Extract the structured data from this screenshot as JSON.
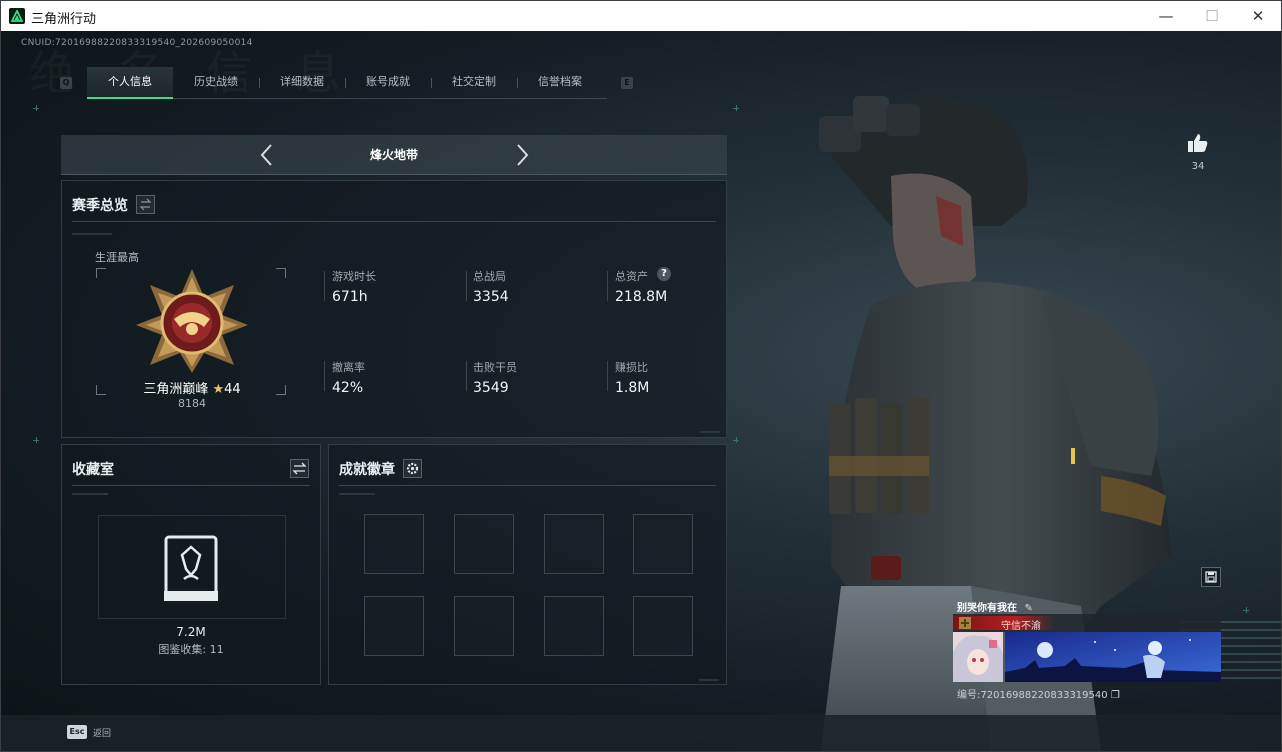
{
  "window": {
    "title": "三角洲行动",
    "minimize": "—",
    "maximize": "☐",
    "close": "✕"
  },
  "header": {
    "uid": "CNUID:72016988220833319540_202609050014",
    "tab_key_left": "Q",
    "tab_key_right": "E",
    "tabs": [
      {
        "label": "个人信息",
        "active": true
      },
      {
        "label": "历史战绩",
        "active": false
      },
      {
        "label": "详细数据",
        "active": false
      },
      {
        "label": "账号成就",
        "active": false
      },
      {
        "label": "社交定制",
        "active": false
      },
      {
        "label": "信誉档案",
        "active": false
      }
    ]
  },
  "season": {
    "mode_title": "烽火地带"
  },
  "overview": {
    "title": "赛季总览",
    "career_label": "生涯最高",
    "rank_name": "三角洲巅峰",
    "rank_stars": "44",
    "rank_score": "8184",
    "stats": [
      {
        "label": "游戏时长",
        "value": "671h"
      },
      {
        "label": "总战局",
        "value": "3354"
      },
      {
        "label": "总资产",
        "value": "218.8M",
        "help": "?"
      },
      {
        "label": "撤离率",
        "value": "42%"
      },
      {
        "label": "击败干员",
        "value": "3549"
      },
      {
        "label": "赚损比",
        "value": "1.8M"
      }
    ]
  },
  "collection": {
    "title": "收藏室",
    "value": "7.2M",
    "count": "图鉴收集: 11"
  },
  "achievements": {
    "title": "成就徽章"
  },
  "player": {
    "likes": "34",
    "card_name": "别哭你有我在",
    "motto": "守信不渝",
    "id_label": "编号:72016988220833319540"
  },
  "footer": {
    "esc_key": "Esc",
    "esc_label": "返回"
  },
  "colors": {
    "accent": "#3ddc84",
    "motto_red": "#b61f1f"
  }
}
